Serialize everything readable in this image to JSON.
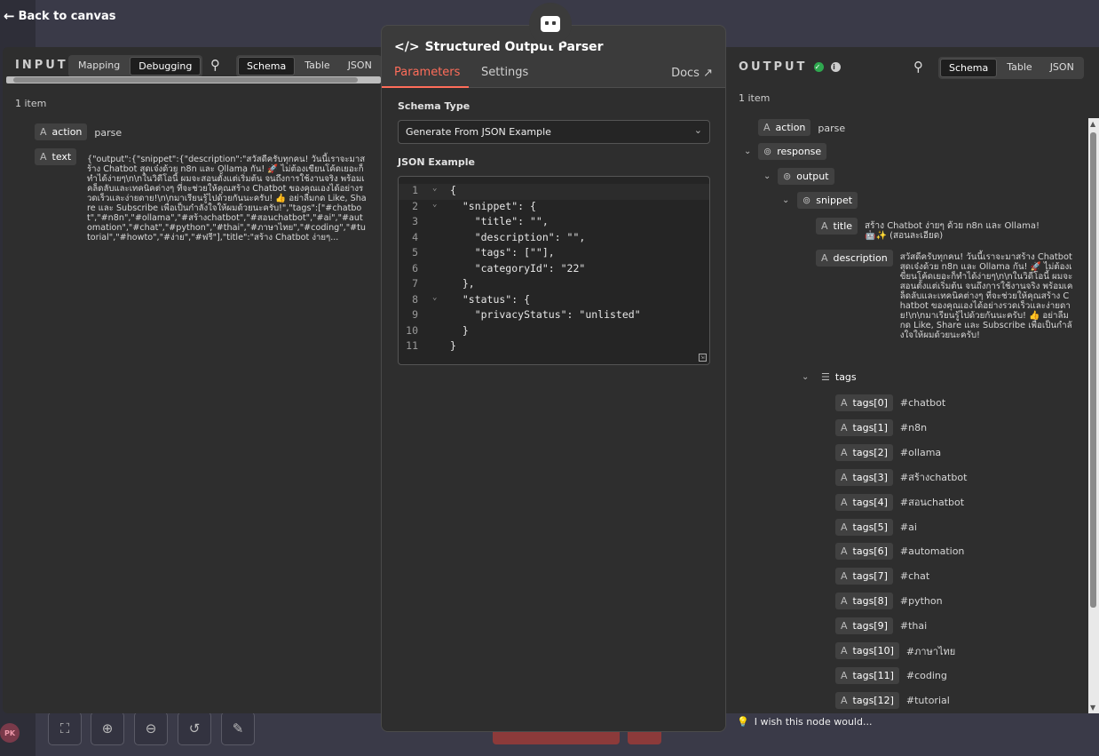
{
  "header": {
    "back_label": "Back to canvas"
  },
  "input": {
    "title": "INPUT",
    "mode_tabs": [
      "Mapping",
      "Debugging"
    ],
    "active_mode": "Debugging",
    "view_tabs": [
      "Schema",
      "Table",
      "JSON"
    ],
    "active_view": "Schema",
    "item_count": "1 item",
    "fields": [
      {
        "type": "A",
        "key": "action",
        "value": "parse"
      },
      {
        "type": "A",
        "key": "text",
        "value": "{\"output\":{\"snippet\":{\"description\":\"สวัสดีครับทุกคน! วันนี้เราจะมาสร้าง Chatbot สุดเจ๋งด้วย n8n และ Ollama กัน! 🚀 ไม่ต้องเขียนโค้ดเยอะก็ทำได้ง่ายๆ\\n\\nในวิดีโอนี้ ผมจะสอนตั้งแต่เริ่มต้น จนถึงการใช้งานจริง พร้อมเคล็ดลับและเทคนิคต่างๆ ที่จะช่วยให้คุณสร้าง Chatbot ของคุณเองได้อย่างรวดเร็วและง่ายดาย!\\n\\nมาเรียนรู้ไปด้วยกันนะครับ! 👍 อย่าลืมกด Like, Share และ Subscribe เพื่อเป็นกำลังใจให้ผมด้วยนะครับ!\",\"tags\":[\"#chatbot\",\"#n8n\",\"#ollama\",\"#สร้างchatbot\",\"#สอนchatbot\",\"#ai\",\"#automation\",\"#chat\",\"#python\",\"#thai\",\"#ภาษาไทย\",\"#coding\",\"#tutorial\",\"#howto\",\"#ง่าย\",\"#ฟรี\"],\"title\":\"สร้าง Chatbot ง่ายๆ..."
      }
    ]
  },
  "node": {
    "title": "Structured Output Parser",
    "tabs": [
      "Parameters",
      "Settings"
    ],
    "active_tab": "Parameters",
    "docs_label": "Docs",
    "schema_type_label": "Schema Type",
    "schema_type_value": "Generate From JSON Example",
    "json_example_label": "JSON Example",
    "code_lines": [
      {
        "n": "1",
        "fold": true,
        "text": "{"
      },
      {
        "n": "2",
        "fold": true,
        "text": "  \"snippet\": {"
      },
      {
        "n": "3",
        "fold": false,
        "text": "    \"title\": \"\","
      },
      {
        "n": "4",
        "fold": false,
        "text": "    \"description\": \"\","
      },
      {
        "n": "5",
        "fold": false,
        "text": "    \"tags\": [\"\"],"
      },
      {
        "n": "6",
        "fold": false,
        "text": "    \"categoryId\": \"22\""
      },
      {
        "n": "7",
        "fold": false,
        "text": "  },"
      },
      {
        "n": "8",
        "fold": true,
        "text": "  \"status\": {"
      },
      {
        "n": "9",
        "fold": false,
        "text": "    \"privacyStatus\": \"unlisted\""
      },
      {
        "n": "10",
        "fold": false,
        "text": "  }"
      },
      {
        "n": "11",
        "fold": false,
        "text": "}"
      }
    ]
  },
  "output": {
    "title": "OUTPUT",
    "view_tabs": [
      "Schema",
      "Table",
      "JSON"
    ],
    "active_view": "Schema",
    "item_count": "1 item",
    "action": {
      "type": "A",
      "key": "action",
      "value": "parse"
    },
    "response_key": "response",
    "output_key": "output",
    "snippet_key": "snippet",
    "title_field": {
      "type": "A",
      "key": "title",
      "value": "สร้าง Chatbot ง่ายๆ ด้วย n8n และ Ollama! 🤖✨ (สอนละเอียด)"
    },
    "description_field": {
      "type": "A",
      "key": "description",
      "value": "สวัสดีครับทุกคน! วันนี้เราจะมาสร้าง Chatbot สุดเจ๋งด้วย n8n และ Ollama กัน! 🚀 ไม่ต้องเขียนโค้ดเยอะก็ทำได้ง่ายๆ\\n\\nในวิดีโอนี้ ผมจะสอนตั้งแต่เริ่มต้น จนถึงการใช้งานจริง พร้อมเคล็ดลับและเทคนิคต่างๆ ที่จะช่วยให้คุณสร้าง Chatbot ของคุณเองได้อย่างรวดเร็วและง่ายดาย!\\n\\nมาเรียนรู้ไปด้วยกันนะครับ! 👍 อย่าลืมกด Like, Share และ Subscribe เพื่อเป็นกำลังใจให้ผมด้วยนะครับ!"
    },
    "tags_key": "tags",
    "tags": [
      {
        "key": "tags[0]",
        "value": "#chatbot"
      },
      {
        "key": "tags[1]",
        "value": "#n8n"
      },
      {
        "key": "tags[2]",
        "value": "#ollama"
      },
      {
        "key": "tags[3]",
        "value": "#สร้างchatbot"
      },
      {
        "key": "tags[4]",
        "value": "#สอนchatbot"
      },
      {
        "key": "tags[5]",
        "value": "#ai"
      },
      {
        "key": "tags[6]",
        "value": "#automation"
      },
      {
        "key": "tags[7]",
        "value": "#chat"
      },
      {
        "key": "tags[8]",
        "value": "#python"
      },
      {
        "key": "tags[9]",
        "value": "#thai"
      },
      {
        "key": "tags[10]",
        "value": "#ภาษาไทย"
      },
      {
        "key": "tags[11]",
        "value": "#coding"
      },
      {
        "key": "tags[12]",
        "value": "#tutorial"
      }
    ]
  },
  "footer": {
    "wish_label": "I wish this node would...",
    "avatar_initials": "PK"
  },
  "colors": {
    "accent": "#ff6d5a",
    "success": "#2fa84f"
  }
}
